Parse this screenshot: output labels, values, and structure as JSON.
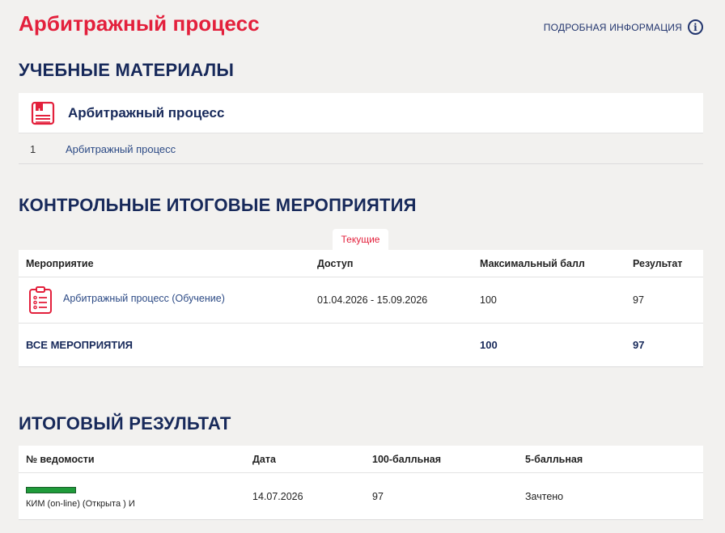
{
  "header": {
    "title": "Арбитражный процесс",
    "info_link": "ПОДРОБНАЯ ИНФОРМАЦИЯ",
    "info_glyph": "i"
  },
  "materials": {
    "section_title": "УЧЕБНЫЕ МАТЕРИАЛЫ",
    "card_title": "Арбитражный процесс",
    "icon": "book-icon",
    "items": [
      {
        "num": "1",
        "label": "Арбитражный процесс"
      }
    ]
  },
  "events": {
    "section_title": "КОНТРОЛЬНЫЕ ИТОГОВЫЕ МЕРОПРИЯТИЯ",
    "tab": "Текущие",
    "columns": [
      "Мероприятие",
      "Доступ",
      "Максимальный балл",
      "Результат"
    ],
    "rows": [
      {
        "icon": "clipboard-list-icon",
        "name": "Арбитражный процесс (Обучение)",
        "access": "01.04.2026 - 15.09.2026",
        "max": "100",
        "result": "97"
      }
    ],
    "total": {
      "label": "ВСЕ МЕРОПРИЯТИЯ",
      "max": "100",
      "result": "97"
    }
  },
  "final": {
    "section_title": "ИТОГОВЫЙ РЕЗУЛЬТАТ",
    "columns": [
      "№ ведомости",
      "Дата",
      "100-балльная",
      "5-балльная"
    ],
    "rows": [
      {
        "sheet": "КИМ (on-line) (Открыта ) И",
        "date": "14.07.2026",
        "score100": "97",
        "score5": "Зачтено"
      }
    ]
  },
  "colors": {
    "accent_red": "#e3203c",
    "navy": "#17295a",
    "link_blue": "#2c4a85",
    "status_green": "#1f9b3a"
  }
}
